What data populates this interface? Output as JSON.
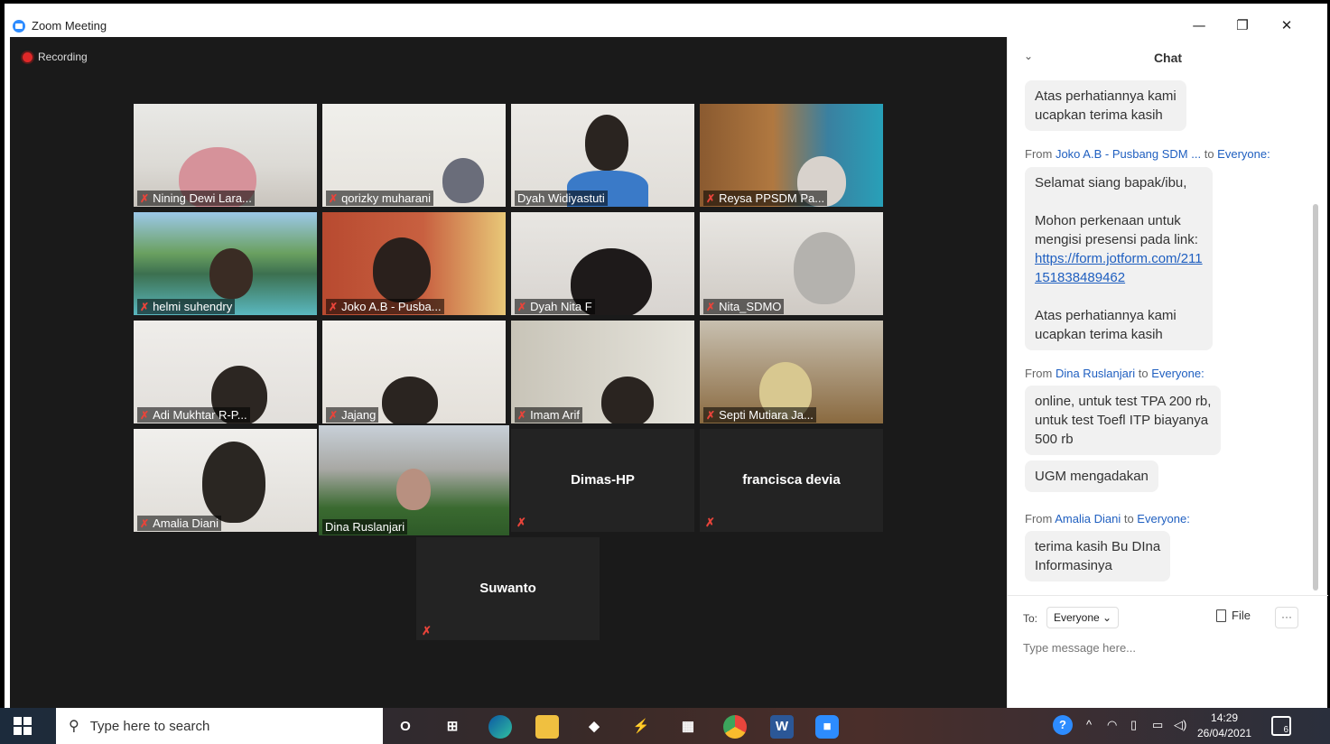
{
  "window": {
    "title": "Zoom Meeting",
    "minimize": "—",
    "restore": "❐",
    "close": "✕"
  },
  "recording": {
    "label": "Recording"
  },
  "participants": [
    {
      "name": "Nining Dewi Lara...",
      "muted": true
    },
    {
      "name": "qorizky muharani",
      "muted": true
    },
    {
      "name": "Dyah Widiyastuti",
      "muted": false
    },
    {
      "name": "Reysa PPSDM Pa...",
      "muted": true
    },
    {
      "name": "helmi suhendry",
      "muted": true
    },
    {
      "name": "Joko A.B - Pusba...",
      "muted": true
    },
    {
      "name": "Dyah Nita F",
      "muted": true
    },
    {
      "name": "Nita_SDMO",
      "muted": true
    },
    {
      "name": "Adi Mukhtar R-P...",
      "muted": true
    },
    {
      "name": "Jajang",
      "muted": true
    },
    {
      "name": "Imam Arif",
      "muted": true
    },
    {
      "name": "Septi Mutiara Ja...",
      "muted": true
    },
    {
      "name": "Amalia Diani",
      "muted": true
    },
    {
      "name": "Dina Ruslanjari",
      "muted": false,
      "active_speaker": true
    },
    {
      "name": "Dimas-HP",
      "muted": true,
      "video_off": true
    },
    {
      "name": "francisca devia",
      "muted": true,
      "video_off": true
    },
    {
      "name": "Suwanto",
      "muted": true,
      "video_off": true
    }
  ],
  "chat": {
    "title": "Chat",
    "messages": [
      {
        "text_lines": [
          "Atas perhatiannya kami",
          "ucapkan terima kasih"
        ]
      },
      {
        "from_prefix": "From ",
        "sender": "Joko A.B - Pusbang SDM ...",
        "to_prefix": " to ",
        "recipient": "Everyone:"
      },
      {
        "text_lines": [
          "Selamat siang bapak/ibu,",
          "",
          "Mohon perkenaan untuk",
          "mengisi presensi pada link:"
        ],
        "link_lines": [
          "https://form.jotform.com/211",
          "151838489462"
        ],
        "text_lines_after": [
          "",
          "Atas perhatiannya kami",
          "ucapkan terima kasih"
        ]
      },
      {
        "from_prefix": "From ",
        "sender": "Dina Ruslanjari",
        "to_prefix": " to ",
        "recipient": "Everyone:"
      },
      {
        "text_lines": [
          "online, untuk test TPA  200 rb,",
          "untuk test Toefl  ITP biayanya",
          "500 rb"
        ]
      },
      {
        "text_lines": [
          "UGM mengadakan"
        ]
      },
      {
        "from_prefix": "From ",
        "sender": "Amalia Diani",
        "to_prefix": " to ",
        "recipient": "Everyone:"
      },
      {
        "text_lines": [
          "terima kasih Bu DIna",
          "Informasinya"
        ]
      }
    ],
    "to_label": "To:",
    "to_value": "Everyone ⌄",
    "file_label": "File",
    "more_label": "···",
    "input_placeholder": "Type message here..."
  },
  "taskbar": {
    "search_placeholder": "Type here to search",
    "cortana": "O",
    "task_view": "⊞",
    "time": "14:29",
    "date": "26/04/2021",
    "notification_count": "6",
    "help": "?",
    "tray_chevron": "^",
    "apps": [
      "edge-icon",
      "file-explorer-icon",
      "dropbox-icon",
      "vs-code-icon",
      "store-icon",
      "chrome-icon",
      "word-icon",
      "zoom-icon"
    ]
  },
  "colors": {
    "accent": "#2d8cff",
    "link": "#1f5fc0",
    "muted": "#e8443a",
    "active_speaker": "#f2e36c"
  }
}
